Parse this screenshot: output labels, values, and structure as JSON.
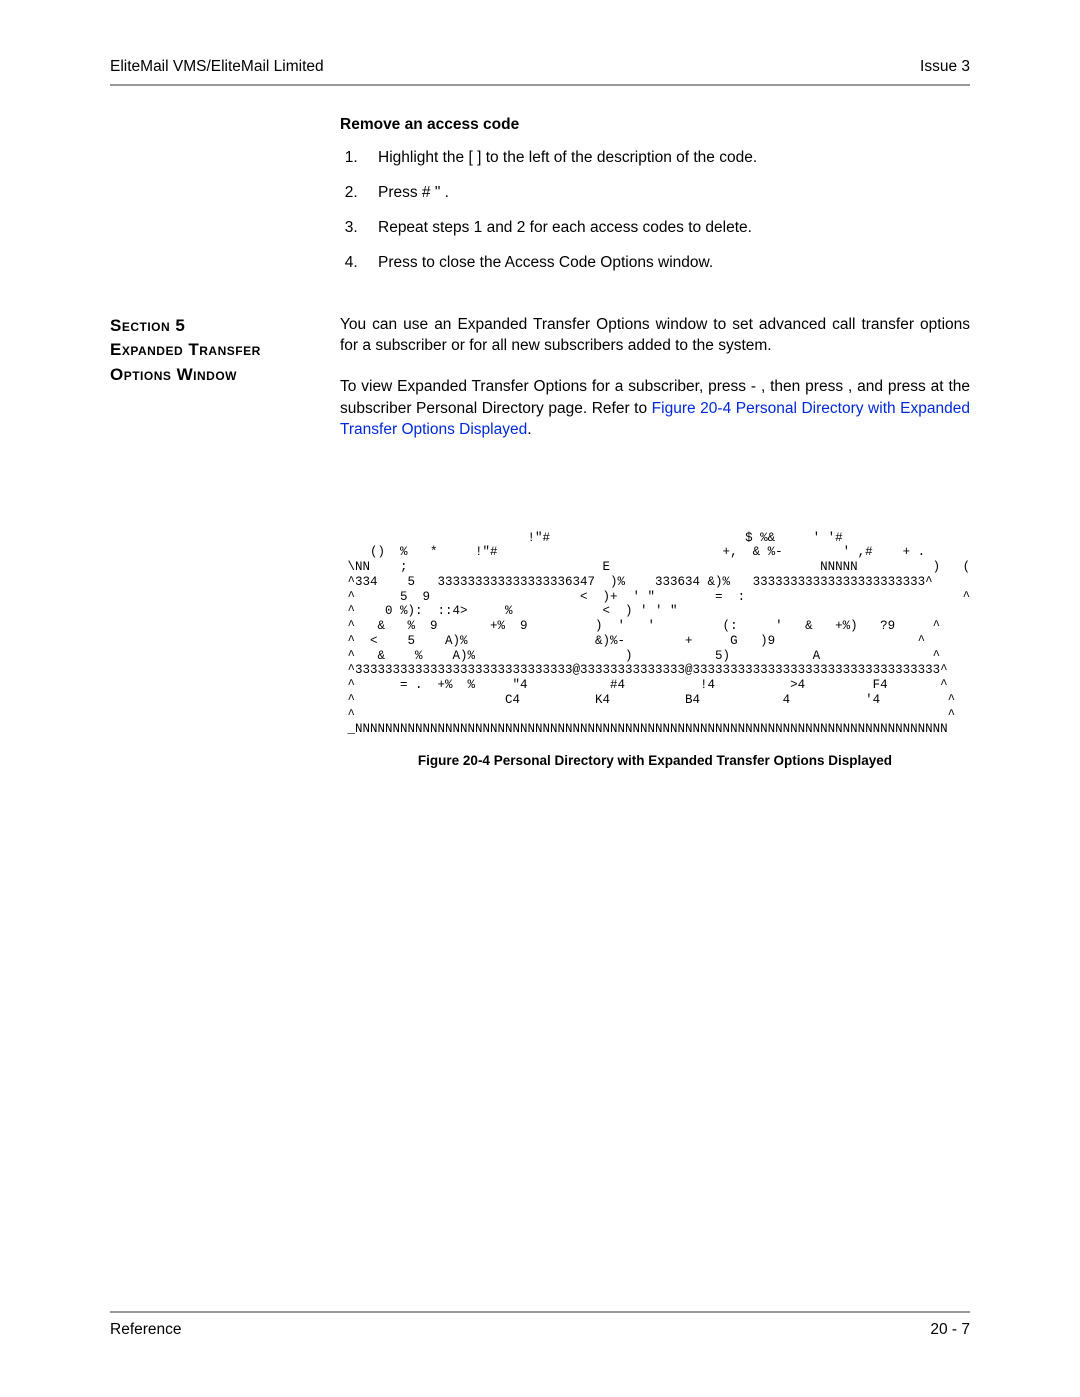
{
  "header": {
    "left": "EliteMail VMS/EliteMail Limited",
    "right": "Issue 3"
  },
  "remove": {
    "title": "Remove an access code",
    "steps": [
      "Highlight the [ ]    to the left of the description of the code.",
      "Press  #    \"   .",
      "Repeat steps 1 and 2 for each access codes to delete.",
      "Press        to close the Access Code Options window."
    ]
  },
  "section": {
    "label_line1": "Section 5",
    "label_line2": "Expanded Transfer",
    "label_line3": "Options Window",
    "para1": "You can use an Expanded Transfer Options window to set advanced call transfer options for a subscriber or for all new subscribers added to the system.",
    "para2a": "To view Expanded Transfer Options for a subscriber, press      -   , then press      , and press            at the subscriber Personal Directory page. Refer to ",
    "link": "Figure 20-4 Personal Directory with Expanded Transfer Options Displayed",
    "para2b": "."
  },
  "figure": {
    "ascii": "                         !\"#                          $ %&     ' '#\n    ()  %   *     !\"#                              +,  & %-        ' ,#    + .\n \\NN    ;                          E                            NNNNN          )   (%)  ]\n ^334    5   333333333333333336347  )%    333634 &)%   33333333333333333333333^\n ^      5  9                    <  )+  ' \"        =  :                             ^\n ^    0 %):  ::4>     %            <  ) ' ' \"                                       ^\n ^   &   %  9       +%  9         )  '   '         (:     '   &   +%)   ?9     ^\n ^  <    5    A)%                 &)%-        +     G   )9                   ^\n ^   &    %    A)%                    )           5)           A               ^\n ^33333333333333333333333333333@33333333333333@333333333333333333333333333333333^\n ^      = .  +%  %     \"4           #4          !4          >4         F4       ^\n ^                    C4          K4          B4           4          '4         ^\n ^                                                                               ^\n _NNNNNNNNNNNNNNNNNNNNNNNNNNNNNNNNNNNNNNNNNNNNNNNNNNNNNNNNNNNNNNNNNNNNNNNNNNNNNNN",
    "caption": "Figure 20-4   Personal Directory with Expanded Transfer Options Displayed"
  },
  "footer": {
    "left": "Reference",
    "right": "20 - 7"
  }
}
